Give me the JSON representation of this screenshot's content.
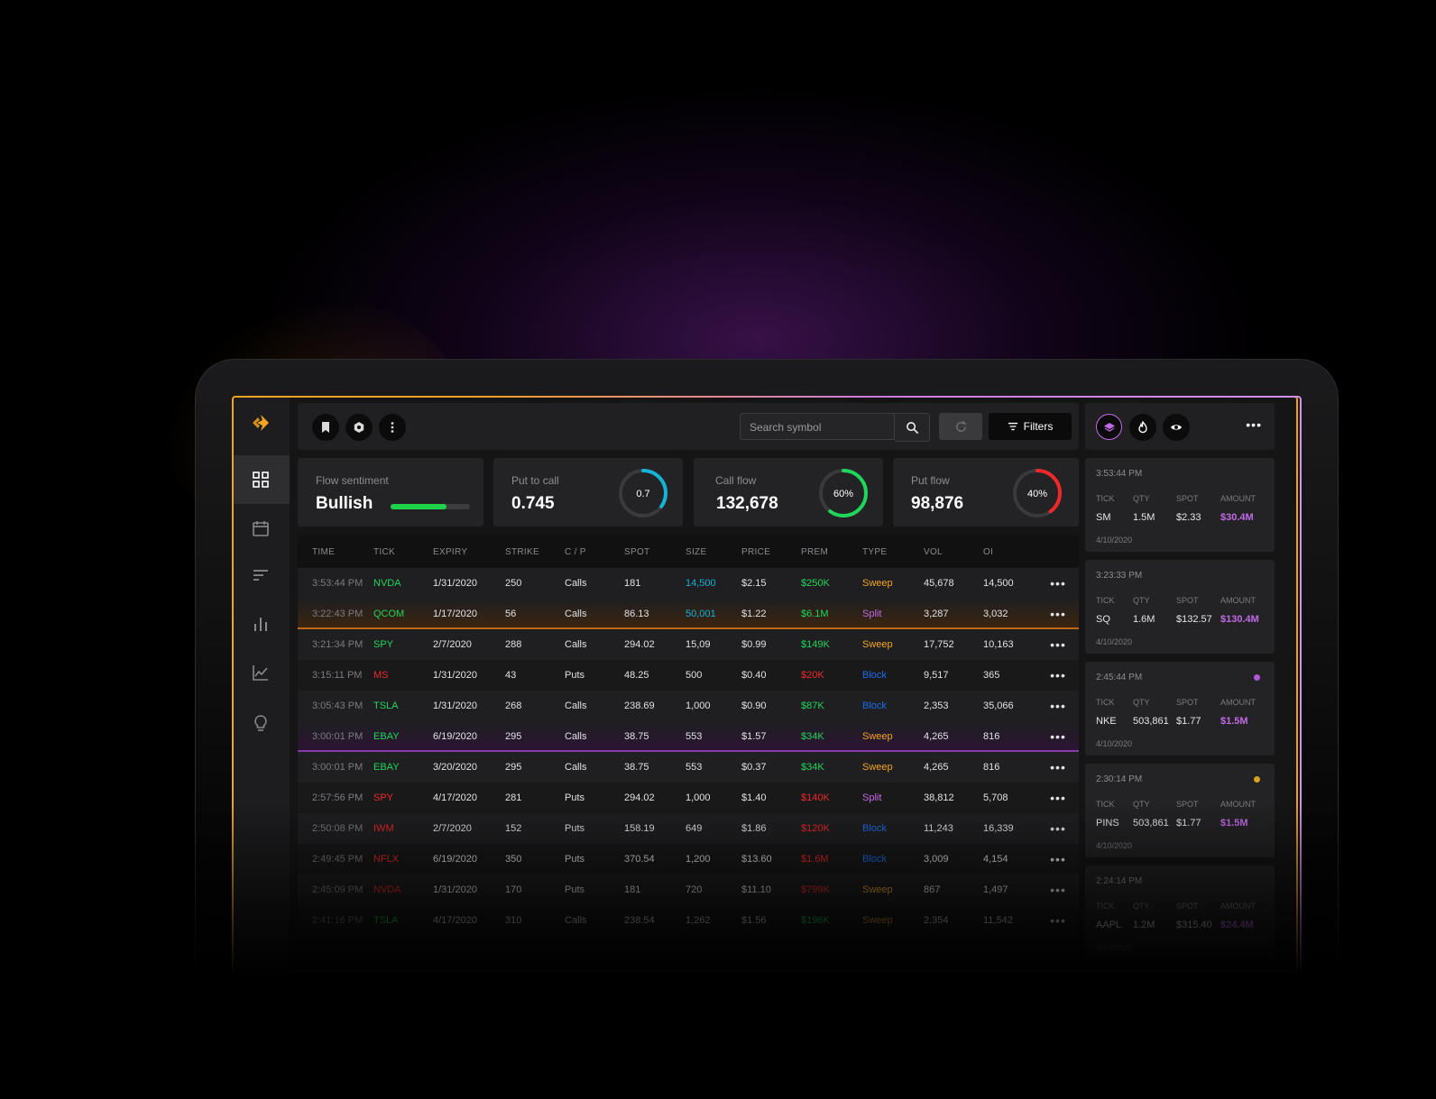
{
  "colors": {
    "accent_orange": "#f3a522",
    "accent_purple": "#c26ae6",
    "green": "#1fd65a",
    "red": "#f0282a",
    "cyan": "#14b3d8",
    "blue": "#1a6ef0"
  },
  "toolbar": {
    "search_placeholder": "Search symbol",
    "filters_label": "Filters"
  },
  "sidebar_icons": [
    "dashboard-icon",
    "calendar-icon",
    "sort-icon",
    "bar-chart-icon",
    "line-chart-icon",
    "lightbulb-icon"
  ],
  "stats": {
    "sentiment": {
      "label": "Flow sentiment",
      "value": "Bullish",
      "bar_fraction": 0.7
    },
    "put_to_call": {
      "label": "Put to call",
      "value": "0.745",
      "ring_text": "0.7",
      "ring_fraction": 0.35,
      "ring_color": "#14b3d8"
    },
    "call_flow": {
      "label": "Call flow",
      "value": "132,678",
      "ring_text": "60%",
      "ring_fraction": 0.6,
      "ring_color": "#1fd65a"
    },
    "put_flow": {
      "label": "Put flow",
      "value": "98,876",
      "ring_text": "40%",
      "ring_fraction": 0.4,
      "ring_color": "#f0282a"
    }
  },
  "table": {
    "headers": [
      "TIME",
      "TICK",
      "EXPIRY",
      "STRIKE",
      "C / P",
      "SPOT",
      "SIZE",
      "PRICE",
      "PREM",
      "TYPE",
      "VOL",
      "OI"
    ],
    "rows": [
      {
        "time": "3:53:44 PM",
        "tick": "NVDA",
        "expiry": "1/31/2020",
        "strike": "250",
        "cp": "Calls",
        "spot": "181",
        "size": "14,500",
        "price": "$2.15",
        "prem": "$250K",
        "type": "Sweep",
        "vol": "45,678",
        "oi": "14,500",
        "more": "•••"
      },
      {
        "time": "3:22:43 PM",
        "tick": "QCOM",
        "expiry": "1/17/2020",
        "strike": "56",
        "cp": "Calls",
        "spot": "86.13",
        "size": "50,001",
        "price": "$1.22",
        "prem": "$6.1M",
        "type": "Split",
        "vol": "3,287",
        "oi": "3,032",
        "more": "•••"
      },
      {
        "time": "3:21:34 PM",
        "tick": "SPY",
        "expiry": "2/7/2020",
        "strike": "288",
        "cp": "Calls",
        "spot": "294.02",
        "size": "15,09",
        "price": "$0.99",
        "prem": "$149K",
        "type": "Sweep",
        "vol": "17,752",
        "oi": "10,163",
        "more": "•••"
      },
      {
        "time": "3:15:11 PM",
        "tick": "MS",
        "expiry": "1/31/2020",
        "strike": "43",
        "cp": "Puts",
        "spot": "48.25",
        "size": "500",
        "price": "$0.40",
        "prem": "$20K",
        "type": "Block",
        "vol": "9,517",
        "oi": "365",
        "more": "•••"
      },
      {
        "time": "3:05:43 PM",
        "tick": "TSLA",
        "expiry": "1/31/2020",
        "strike": "268",
        "cp": "Calls",
        "spot": "238.69",
        "size": "1,000",
        "price": "$0.90",
        "prem": "$87K",
        "type": "Block",
        "vol": "2,353",
        "oi": "35,066",
        "more": "•••"
      },
      {
        "time": "3:00:01 PM",
        "tick": "EBAY",
        "expiry": "6/19/2020",
        "strike": "295",
        "cp": "Calls",
        "spot": "38.75",
        "size": "553",
        "price": "$1.57",
        "prem": "$34K",
        "type": "Sweep",
        "vol": "4,265",
        "oi": "816",
        "more": "•••"
      },
      {
        "time": "3:00:01 PM",
        "tick": "EBAY",
        "expiry": "3/20/2020",
        "strike": "295",
        "cp": "Calls",
        "spot": "38.75",
        "size": "553",
        "price": "$0.37",
        "prem": "$34K",
        "type": "Sweep",
        "vol": "4,265",
        "oi": "816",
        "more": "•••"
      },
      {
        "time": "2:57:56 PM",
        "tick": "SPY",
        "expiry": "4/17/2020",
        "strike": "281",
        "cp": "Puts",
        "spot": "294.02",
        "size": "1,000",
        "price": "$1.40",
        "prem": "$140K",
        "type": "Split",
        "vol": "38,812",
        "oi": "5,708",
        "more": "•••"
      },
      {
        "time": "2:50:08 PM",
        "tick": "IWM",
        "expiry": "2/7/2020",
        "strike": "152",
        "cp": "Puts",
        "spot": "158.19",
        "size": "649",
        "price": "$1.86",
        "prem": "$120K",
        "type": "Block",
        "vol": "11,243",
        "oi": "16,339",
        "more": "•••"
      },
      {
        "time": "2:49:45 PM",
        "tick": "NFLX",
        "expiry": "6/19/2020",
        "strike": "350",
        "cp": "Puts",
        "spot": "370.54",
        "size": "1,200",
        "price": "$13.60",
        "prem": "$1.6M",
        "type": "Block",
        "vol": "3,009",
        "oi": "4,154",
        "more": "•••"
      },
      {
        "time": "2:45:09 PM",
        "tick": "NVDA",
        "expiry": "1/31/2020",
        "strike": "170",
        "cp": "Puts",
        "spot": "181",
        "size": "720",
        "price": "$11.10",
        "prem": "$799K",
        "type": "Sweep",
        "vol": "867",
        "oi": "1,497",
        "more": "•••"
      },
      {
        "time": "2:41:16 PM",
        "tick": "TSLA",
        "expiry": "4/17/2020",
        "strike": "310",
        "cp": "Calls",
        "spot": "238.54",
        "size": "1,262",
        "price": "$1.56",
        "prem": "$196K",
        "type": "Sweep",
        "vol": "2,354",
        "oi": "11,542",
        "more": "•••"
      }
    ]
  },
  "alerts": [
    {
      "time": "3:53:44 PM",
      "headers": [
        "TICK",
        "QTY",
        "SPOT",
        "AMOUNT"
      ],
      "tick": "SM",
      "qty": "1.5M",
      "spot": "$2.33",
      "amount": "$30.4M",
      "date": "4/10/2020",
      "dot": ""
    },
    {
      "time": "3:23:33 PM",
      "headers": [
        "TICK",
        "QTY",
        "SPOT",
        "AMOUNT"
      ],
      "tick": "SQ",
      "qty": "1.6M",
      "spot": "$132.57",
      "amount": "$130.4M",
      "date": "4/10/2020",
      "dot": ""
    },
    {
      "time": "2:45:44 PM",
      "headers": [
        "TICK",
        "QTY",
        "SPOT",
        "AMOUNT"
      ],
      "tick": "NKE",
      "qty": "503,861",
      "spot": "$1.77",
      "amount": "$1.5M",
      "date": "4/10/2020",
      "dot": "#b455e0"
    },
    {
      "time": "2:30:14 PM",
      "headers": [
        "TICK",
        "QTY",
        "SPOT",
        "AMOUNT"
      ],
      "tick": "PINS",
      "qty": "503,861",
      "spot": "$1.77",
      "amount": "$1.5M",
      "date": "4/10/2020",
      "dot": "#d9a21c"
    },
    {
      "time": "2:24:14 PM",
      "headers": [
        "TICK",
        "QTY",
        "SPOT",
        "AMOUNT"
      ],
      "tick": "AAPL",
      "qty": "1.2M",
      "spot": "$315.40",
      "amount": "$24.4M",
      "date": "4/10/2020",
      "dot": ""
    }
  ]
}
